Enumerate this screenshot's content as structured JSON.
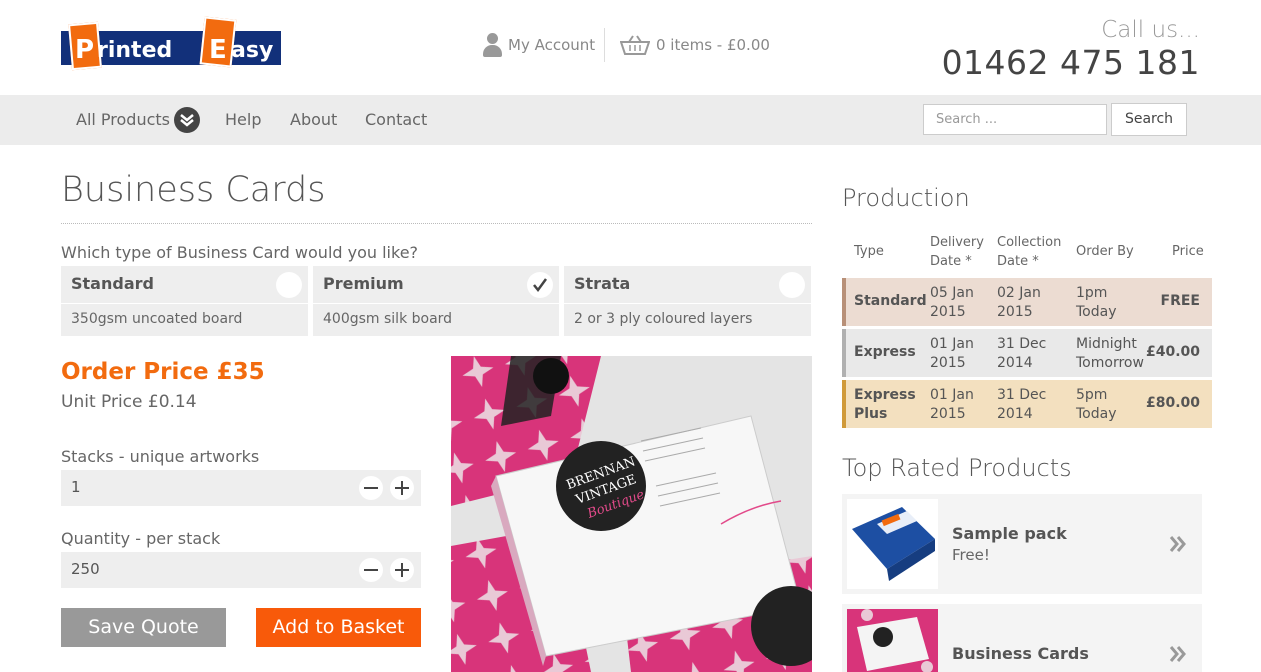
{
  "brand": {
    "logo_word_1": "Printed",
    "logo_word_2": "Easy",
    "logo_letter_1": "P",
    "logo_letter_2": "E"
  },
  "header": {
    "account_label": "My Account",
    "basket_label": "0 items - £0.00",
    "call_label": "Call us...",
    "phone": "01462 475 181"
  },
  "nav": {
    "items": [
      "All Products",
      "Help",
      "About",
      "Contact"
    ],
    "search_placeholder": "Search ...",
    "search_button": "Search"
  },
  "product": {
    "title": "Business Cards",
    "question": "Which type of Business Card would you like?",
    "types": [
      {
        "name": "Standard",
        "desc": "350gsm uncoated board",
        "selected": false
      },
      {
        "name": "Premium",
        "desc": "400gsm silk board",
        "selected": true
      },
      {
        "name": "Strata",
        "desc": "2 or 3 ply coloured layers",
        "selected": false
      }
    ],
    "order_price": "Order Price £35",
    "unit_price": "Unit Price £0.14",
    "stacks_label": "Stacks - unique artworks",
    "stacks_value": "1",
    "quantity_label": "Quantity - per stack",
    "quantity_value": "250",
    "save_button": "Save Quote",
    "add_button": "Add to Basket",
    "image_card_text": {
      "line1": "BRENNAN",
      "line2": "VINTAGE",
      "line3": "Boutique"
    }
  },
  "production": {
    "heading": "Production",
    "headers": {
      "type": "Type",
      "delivery": [
        "Delivery",
        "Date *"
      ],
      "collection": [
        "Collection",
        "Date *"
      ],
      "order_by": "Order By",
      "price": "Price"
    },
    "rows": [
      {
        "type": [
          "Standard",
          ""
        ],
        "delivery": [
          "05 Jan",
          "2015"
        ],
        "collection": [
          "02 Jan",
          "2015"
        ],
        "order_by": [
          "1pm",
          "Today"
        ],
        "price": "FREE",
        "bg": "#ecdcd2",
        "bar": "#b89078"
      },
      {
        "type": [
          "Express",
          ""
        ],
        "delivery": [
          "01 Jan",
          "2015"
        ],
        "collection": [
          "31 Dec",
          "2014"
        ],
        "order_by": [
          "Midnight",
          "Tomorrow"
        ],
        "price": "£40.00",
        "bg": "#e9e9e9",
        "bar": "#b0b0b0"
      },
      {
        "type": [
          "Express",
          "Plus"
        ],
        "delivery": [
          "01 Jan",
          "2015"
        ],
        "collection": [
          "31 Dec",
          "2014"
        ],
        "order_by": [
          "5pm",
          "Today"
        ],
        "price": "£80.00",
        "bg": "#f3e0bf",
        "bar": "#d09a3a"
      }
    ]
  },
  "top_rated": {
    "heading": "Top Rated Products",
    "items": [
      {
        "name": "Sample pack",
        "sub": "Free!"
      },
      {
        "name": "Business Cards",
        "sub": ""
      }
    ]
  },
  "colors": {
    "accent": "#f26b0f",
    "logo_blue": "#12307a",
    "nav_bg": "#ececec",
    "pink": "#d8347a"
  }
}
